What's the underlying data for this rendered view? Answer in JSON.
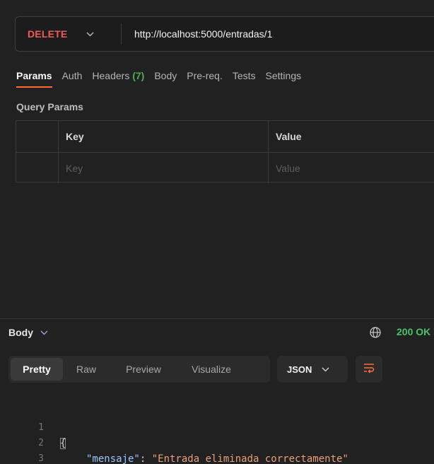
{
  "request": {
    "method": "DELETE",
    "url": "http://localhost:5000/entradas/1"
  },
  "tabs": [
    {
      "label": "Params"
    },
    {
      "label": "Auth"
    },
    {
      "label": "Headers",
      "count": "(7)"
    },
    {
      "label": "Body"
    },
    {
      "label": "Pre-req."
    },
    {
      "label": "Tests"
    },
    {
      "label": "Settings"
    }
  ],
  "query_params": {
    "title": "Query Params",
    "columns": [
      "Key",
      "Value"
    ],
    "placeholders": {
      "key": "Key",
      "value": "Value"
    }
  },
  "response": {
    "title": "Body",
    "status": "200 OK",
    "view_modes": [
      "Pretty",
      "Raw",
      "Preview",
      "Visualize"
    ],
    "active_view": "Pretty",
    "format": "JSON",
    "code": {
      "line_numbers": [
        "1",
        "2",
        "3"
      ],
      "open_brace": "{",
      "key": "\"mensaje\"",
      "colon": ": ",
      "value": "\"Entrada eliminada correctamente\"",
      "close_brace": "}"
    }
  },
  "icons": {
    "method_dropdown": "chevron-down-icon",
    "response_dropdown": "chevron-down-icon",
    "network": "globe-icon",
    "format_dropdown": "chevron-down-icon",
    "wrap": "wrap-lines-icon"
  },
  "colors": {
    "method_delete": "#f05a5a",
    "active_tab_underline": "#ff6c37",
    "status_ok": "#49c06a",
    "json_key": "#9cc4ff",
    "json_string": "#e9a07a"
  }
}
